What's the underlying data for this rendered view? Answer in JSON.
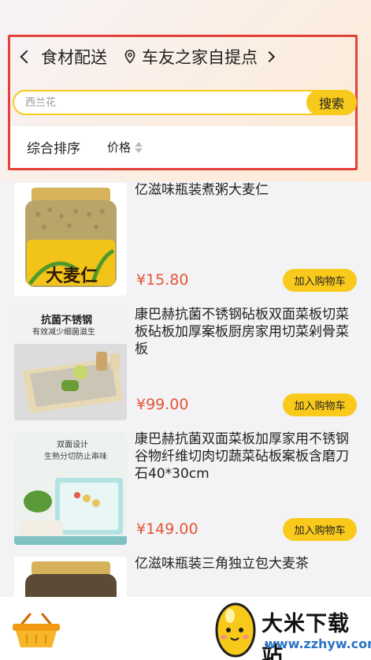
{
  "header": {
    "title": "食材配送",
    "location": "车友之家自提点"
  },
  "search": {
    "placeholder": "西兰花",
    "button": "搜索"
  },
  "sort": {
    "default": "综合排序",
    "price": "价格"
  },
  "products": [
    {
      "title": "亿滋味瓶装煮粥大麦仁",
      "price": "¥15.80",
      "cart_label": "加入购物车",
      "image_text": [
        "大麦仁"
      ]
    },
    {
      "title": "康巴赫抗菌不锈钢砧板双面菜板切菜板砧板加厚案板厨房家用切菜剁骨菜板",
      "price": "¥99.00",
      "cart_label": "加入购物车",
      "image_text": [
        "抗菌不锈钢",
        "有效减少细菌滋生"
      ]
    },
    {
      "title": "康巴赫抗菌双面菜板加厚家用不锈钢谷物纤维切肉切蔬菜砧板案板含磨刀石40*30cm",
      "price": "¥149.00",
      "cart_label": "加入购物车",
      "image_text": [
        "双面设计",
        "生熟分切防止串味"
      ]
    },
    {
      "title": "亿滋味瓶装三角独立包大麦茶",
      "price": "",
      "cart_label": "",
      "image_text": []
    }
  ],
  "footer": {
    "brand_name": "大米下载站",
    "brand_url": "www.zzhyw.com"
  },
  "colors": {
    "accent": "#f9ca1c",
    "price": "#e45535",
    "highlight_border": "#e2423a"
  },
  "icons": [
    "back-chevron-icon",
    "location-pin-icon",
    "chevron-right-icon",
    "sort-arrows-icon",
    "shopping-basket-icon"
  ]
}
